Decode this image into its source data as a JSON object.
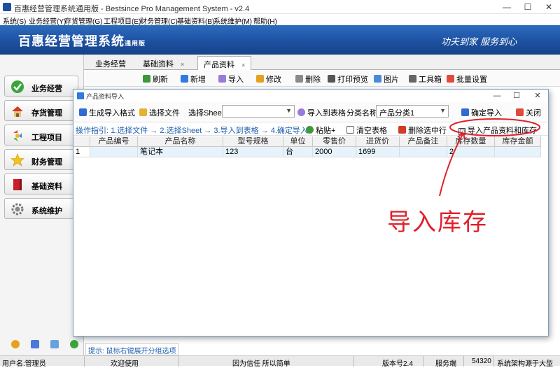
{
  "window": {
    "title": "百惠经营管理系统通用版 - Bestsince Pro Management System - v2.4"
  },
  "menu": [
    "系统(S)",
    "业务经营(Y)",
    "存货管理(G)",
    "工程项目(E)",
    "财务管理(C)",
    "基础资料(B)",
    "系统维护(M)",
    "帮助(H)"
  ],
  "banner": {
    "title": "百惠经营管理系统",
    "edition": "通用版",
    "slogan": "功夫到家 服务到心"
  },
  "sidebar": [
    {
      "label": "业务经营",
      "icon": "check-icon"
    },
    {
      "label": "存货管理",
      "icon": "house-icon"
    },
    {
      "label": "工程项目",
      "icon": "recycle-icon"
    },
    {
      "label": "财务管理",
      "icon": "star-icon"
    },
    {
      "label": "基础资料",
      "icon": "book-icon"
    },
    {
      "label": "系统维护",
      "icon": "gear-icon"
    }
  ],
  "tabs": [
    {
      "label": "业务经营",
      "close": ""
    },
    {
      "label": "基础资料",
      "close": "×"
    },
    {
      "label": "产品资料",
      "close": "×"
    }
  ],
  "toolbar": [
    "刷新",
    "新增",
    "导入",
    "修改",
    "删除",
    "打印预览",
    "图片",
    "工具箱",
    "批量设置"
  ],
  "hint": "提示: 鼠标右键展开分组选项",
  "status": {
    "user": "用户名:管理员",
    "welcome": "欢迎使用",
    "motto": "因为信任 所以简单",
    "version": "版本号2.4",
    "service": "服务端",
    "port": "54320",
    "arch": "系统架构源于大型"
  },
  "dialog": {
    "title": "产品资料导入",
    "gen_format": "生成导入格式",
    "choose_file": "选择文件",
    "choose_sheet_label": "选择Sheet",
    "sheet_value": "",
    "import_to_table": "导入到表格",
    "category_label": "分类名称",
    "category_value": "产品分类1",
    "confirm_import": "确定导入",
    "close": "关闭",
    "guide": "操作指引: 1.选择文件 → 2.选择Sheet → 3.导入到表格 → 4.确定导入",
    "paste": "粘贴+",
    "clear_table": "清空表格",
    "delete_row": "删除选中行",
    "import_stock_label": "导入产品资料和库存",
    "import_stock_checked": "☑",
    "columns": [
      "",
      "产品编号",
      "产品名称",
      "型号规格",
      "单位",
      "零售价",
      "进货价",
      "产品备注",
      "库存数量",
      "库存金额"
    ],
    "rows": [
      [
        "1",
        "",
        "笔记本",
        "123",
        "台",
        "2000",
        "1699",
        "",
        "2",
        ""
      ]
    ]
  },
  "annotation": {
    "text": "导入库存",
    "color": "#e0202a"
  }
}
